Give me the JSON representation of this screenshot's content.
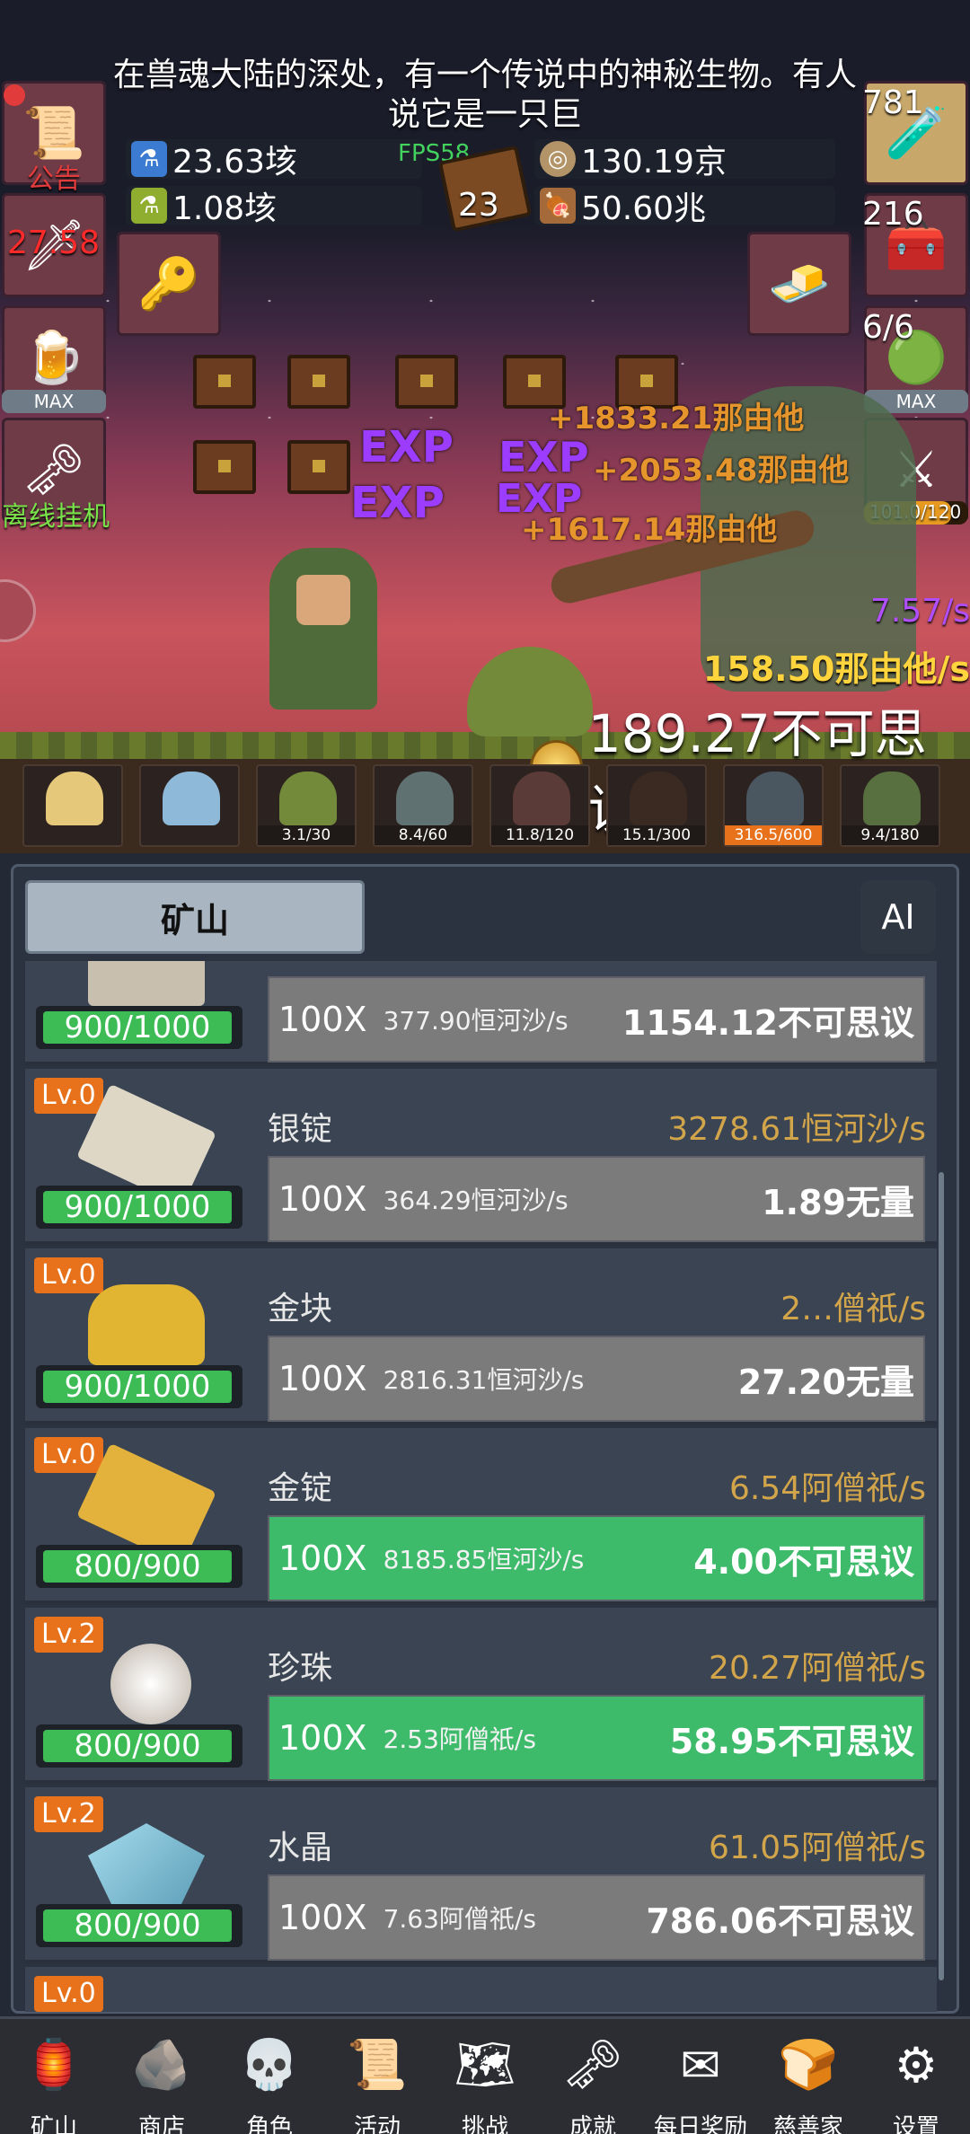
{
  "announcement": "在兽魂大陆的深处，有一个传说中的神秘生物。有人说它是一只巨",
  "fps": "FPS58",
  "resources": {
    "potion_blue": "23.63垓",
    "potion_green": "1.08垓",
    "book_count": "23",
    "coin": "130.19京",
    "meat": "50.60兆"
  },
  "left_buttons": {
    "notice_label": "公告",
    "sword_timer": "27.58",
    "beer_max": "MAX",
    "offline_label": "离线挂机"
  },
  "right_buttons": {
    "potion_count": "781",
    "chest_count": "216",
    "slime_count": "6/6",
    "slime_max": "MAX",
    "sword_progress": "101.0/120"
  },
  "battle": {
    "floats": [
      "+1833.21那由他",
      "+2053.48那由他",
      "+1617.14那由他",
      "EXP",
      "EXP",
      "EXP",
      "EXP"
    ],
    "rate_purple": "7.57/s",
    "rate_gold": "158.50那由他/s",
    "total_gold": "189.27不可思议",
    "slots": [
      {
        "label": "",
        "highlight": false
      },
      {
        "label": "",
        "highlight": false
      },
      {
        "label": "3.1/30",
        "highlight": false
      },
      {
        "label": "8.4/60",
        "highlight": false
      },
      {
        "label": "11.8/120",
        "highlight": false
      },
      {
        "label": "15.1/300",
        "highlight": false
      },
      {
        "label": "316.5/600",
        "highlight": true
      },
      {
        "label": "9.4/180",
        "highlight": false
      }
    ]
  },
  "panel": {
    "tab_label": "矿山",
    "ai_label": "AI",
    "rows": [
      {
        "lv": "",
        "name": "",
        "rate": "",
        "cap": "900/1000",
        "mult": "100X",
        "sub": "377.90恒河沙/s",
        "cost": "1154.12不可思议",
        "green": false
      },
      {
        "lv": "Lv.0",
        "name": "银锭",
        "rate": "3278.61恒河沙/s",
        "cap": "900/1000",
        "mult": "100X",
        "sub": "364.29恒河沙/s",
        "cost": "1.89无量",
        "green": false
      },
      {
        "lv": "Lv.0",
        "name": "金块",
        "rate": "2…僧祇/s",
        "cap": "900/1000",
        "mult": "100X",
        "sub": "2816.31恒河沙/s",
        "cost": "27.20无量",
        "green": false
      },
      {
        "lv": "Lv.0",
        "name": "金锭",
        "rate": "6.54阿僧祇/s",
        "cap": "800/900",
        "mult": "100X",
        "sub": "8185.85恒河沙/s",
        "cost": "4.00不可思议",
        "green": true
      },
      {
        "lv": "Lv.2",
        "name": "珍珠",
        "rate": "20.27阿僧祇/s",
        "cap": "800/900",
        "mult": "100X",
        "sub": "2.53阿僧祇/s",
        "cost": "58.95不可思议",
        "green": true
      },
      {
        "lv": "Lv.2",
        "name": "水晶",
        "rate": "61.05阿僧祇/s",
        "cap": "800/900",
        "mult": "100X",
        "sub": "7.63阿僧祇/s",
        "cost": "786.06不可思议",
        "green": false
      },
      {
        "lv": "Lv.0",
        "name": "",
        "rate": "",
        "cap": "",
        "mult": "",
        "sub": "",
        "cost": "",
        "green": false
      }
    ]
  },
  "nav": [
    {
      "label": "矿山",
      "icon": "lantern-icon"
    },
    {
      "label": "商店",
      "icon": "stone-tablet-icon"
    },
    {
      "label": "角色",
      "icon": "skull-icon"
    },
    {
      "label": "活动",
      "icon": "scroll-icon"
    },
    {
      "label": "挑战",
      "icon": "map-icon"
    },
    {
      "label": "成就",
      "icon": "key-icon"
    },
    {
      "label": "每日奖励",
      "icon": "envelope-icon"
    },
    {
      "label": "慈善家",
      "icon": "bread-icon"
    },
    {
      "label": "设置",
      "icon": "gear-icon"
    }
  ]
}
